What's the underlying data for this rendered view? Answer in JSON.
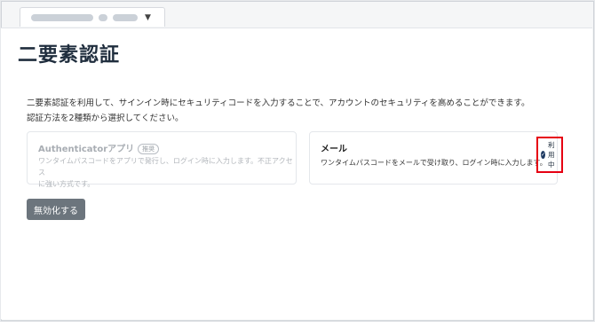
{
  "tab": {
    "dropdown_icon": "caret-down-icon"
  },
  "page": {
    "title": "二要素認証"
  },
  "description": {
    "line1": "二要素認証を利用して、サインイン時にセキュリティコードを入力することで、アカウントのセキュリティを高めることができます。",
    "line2": "認証方法を2種類から選択してください。"
  },
  "methods": {
    "authenticator": {
      "title": "Authenticatorアプリ",
      "badge": "推奨",
      "text1": "ワンタイムパスコードをアプリで発行し、ログイン時に入力します。不正アクセス",
      "text2": "に強い方式です。"
    },
    "email": {
      "title": "メール",
      "text": "ワンタイムパスコードをメールで受け取り、ログイン時に入力します。",
      "status_label": "利用中",
      "status_icon": "check-circle-icon"
    }
  },
  "actions": {
    "disable_label": "無効化する"
  },
  "colors": {
    "highlight": "#e60012",
    "button": "#6c757d",
    "title": "#1f2d3d"
  }
}
